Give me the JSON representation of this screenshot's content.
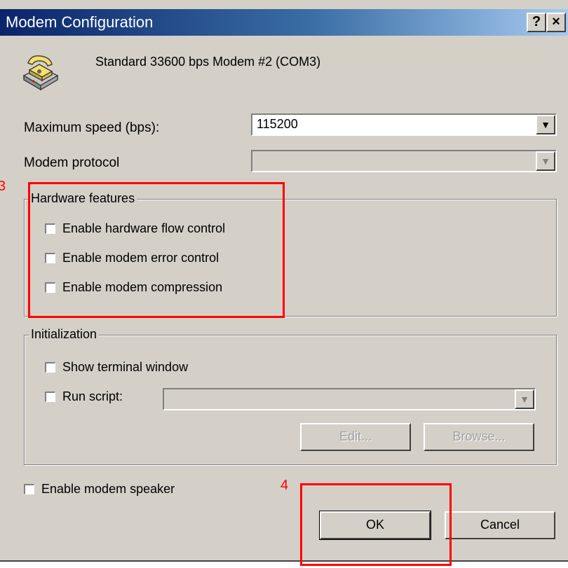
{
  "window": {
    "title": "Modem Configuration",
    "help_label": "?",
    "close_label": "×"
  },
  "header": {
    "modem_icon": "telephone-modem-icon",
    "modem_name": "Standard 33600 bps Modem #2 (COM3)"
  },
  "fields": {
    "max_speed_label": "Maximum speed (bps):",
    "max_speed_value": "115200",
    "protocol_label": "Modem protocol",
    "protocol_value": ""
  },
  "hardware_features": {
    "legend": "Hardware features",
    "items": [
      {
        "label": "Enable hardware flow control",
        "checked": false
      },
      {
        "label": "Enable modem error control",
        "checked": false
      },
      {
        "label": "Enable modem compression",
        "checked": false
      }
    ]
  },
  "initialization": {
    "legend": "Initialization",
    "show_terminal_label": "Show terminal window",
    "run_script_label": "Run script:",
    "script_value": "",
    "edit_label": "Edit...",
    "browse_label": "Browse..."
  },
  "speaker": {
    "label": "Enable modem speaker",
    "checked": false
  },
  "buttons": {
    "ok_label": "OK",
    "cancel_label": "Cancel"
  },
  "annotations": {
    "box3_label": "3",
    "box4_label": "4",
    "color": "#ff0000"
  },
  "colors": {
    "dialog_bg": "#d4d0c8",
    "title_start": "#0a246a",
    "title_end": "#a6caf0"
  }
}
